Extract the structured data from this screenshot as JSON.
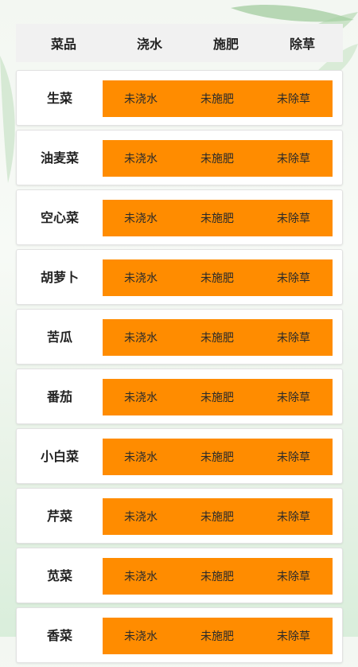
{
  "header": {
    "name": "菜品",
    "water": "浇水",
    "fertilize": "施肥",
    "weed": "除草"
  },
  "status_labels": {
    "water": "未浇水",
    "fertilize": "未施肥",
    "weed": "未除草"
  },
  "accent_color": "#ff8c00",
  "rows": [
    {
      "name": "生菜"
    },
    {
      "name": "油麦菜"
    },
    {
      "name": "空心菜"
    },
    {
      "name": "胡萝卜"
    },
    {
      "name": "苦瓜"
    },
    {
      "name": "番茄"
    },
    {
      "name": "小白菜"
    },
    {
      "name": "芹菜"
    },
    {
      "name": "苋菜"
    },
    {
      "name": "香菜"
    }
  ]
}
